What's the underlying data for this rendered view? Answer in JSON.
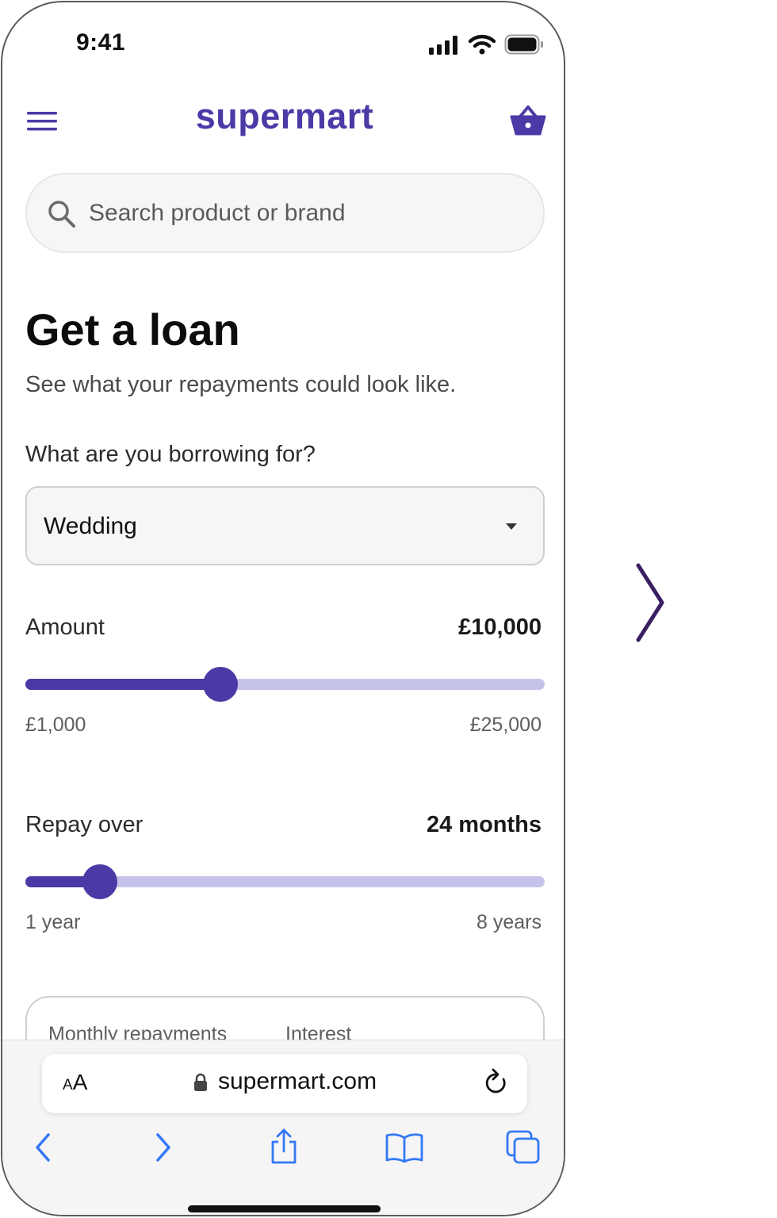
{
  "status_bar": {
    "time": "9:41",
    "icons": [
      "signal-icon",
      "wifi-icon",
      "battery-icon"
    ]
  },
  "header": {
    "brand": "supermart",
    "menu_icon": "hamburger-menu-icon",
    "basket_icon": "basket-icon",
    "brand_color": "#4b3aa6"
  },
  "search": {
    "placeholder": "Search product or brand",
    "value": ""
  },
  "main": {
    "title": "Get a loan",
    "subtitle": "See what your repayments could look like.",
    "purpose_label": "What are you borrowing for?",
    "purpose_selected": "Wedding",
    "amount": {
      "label": "Amount",
      "value": "£10,000",
      "min_label": "£1,000",
      "max_label": "£25,000",
      "min": 1000,
      "max": 25000,
      "current": 10000
    },
    "term": {
      "label": "Repay over",
      "value": "24 months",
      "min_label": "1 year",
      "max_label": "8 years",
      "min_months": 12,
      "max_months": 96,
      "current_months": 24
    },
    "results": {
      "monthly_label": "Monthly repayments",
      "interest_label": "Interest"
    }
  },
  "browser": {
    "text_size_label_small": "A",
    "text_size_label_large": "A",
    "url": "supermart.com",
    "toolbar_icons": [
      "back-icon",
      "forward-icon",
      "share-icon",
      "bookmarks-icon",
      "tabs-icon"
    ]
  },
  "colors": {
    "accent": "#4b3aa6",
    "track": "#c6c3ea",
    "ios_blue": "#3478f6",
    "next_arrow": "#3a1f63"
  }
}
